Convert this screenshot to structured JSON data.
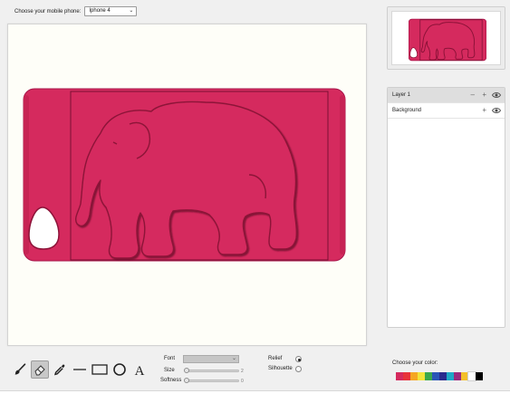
{
  "header": {
    "phone_label": "Choose your mobile phone:",
    "phone_selected": "Iphone 4"
  },
  "canvas": {
    "case_color": "#d52a5e",
    "subject": "elephant"
  },
  "thumbnail": {
    "case_color": "#d52a5e"
  },
  "layers": [
    {
      "name": "Layer 1",
      "selected": true,
      "minus": "–",
      "plus": "+"
    },
    {
      "name": "Background",
      "selected": false,
      "plus": "+"
    }
  ],
  "tools": [
    {
      "name": "brush-tool",
      "icon": "brush-icon"
    },
    {
      "name": "eraser-tool",
      "icon": "eraser-icon",
      "active": true
    },
    {
      "name": "picker-tool",
      "icon": "eyedropper-icon"
    },
    {
      "name": "line-tool",
      "icon": "line-icon"
    },
    {
      "name": "rectangle-tool",
      "icon": "rectangle-icon"
    },
    {
      "name": "circle-tool",
      "icon": "circle-icon"
    },
    {
      "name": "text-tool",
      "icon": "text-icon"
    }
  ],
  "properties": {
    "font_label": "Font",
    "font_value": "",
    "size_label": "Size",
    "size_value": "2",
    "softness_label": "Softness",
    "softness_value": "0"
  },
  "modes": {
    "relief_label": "Relief",
    "silhouette_label": "Silhouette",
    "selected": "Relief"
  },
  "colors": {
    "label": "Choose your color:",
    "swatches": [
      "#d52a5e",
      "#e8323a",
      "#f5a623",
      "#f2e43a",
      "#3aa84c",
      "#2a56b6",
      "#2a2a8e",
      "#1ea7c6",
      "#9a2a7e",
      "#f3c02a",
      "#ffffff",
      "#000000"
    ],
    "selected": "#d52a5e"
  }
}
